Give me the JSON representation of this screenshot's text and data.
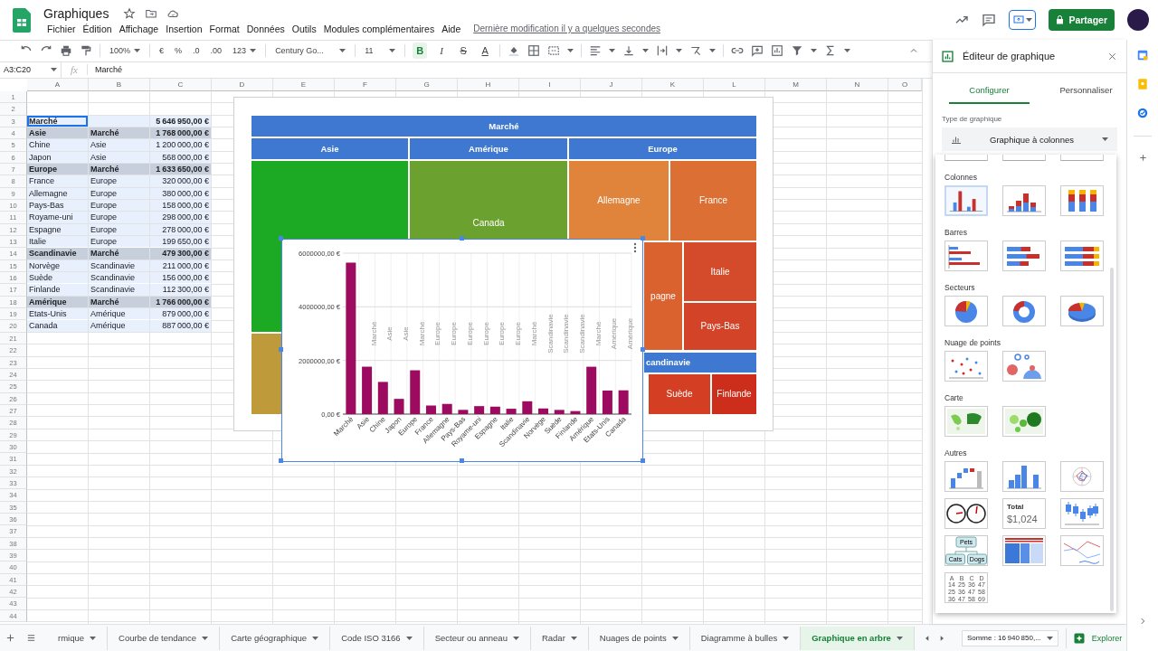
{
  "app": {
    "title": "Graphiques",
    "menus": [
      "Fichier",
      "Édition",
      "Affichage",
      "Insertion",
      "Format",
      "Données",
      "Outils",
      "Modules complémentaires",
      "Aide"
    ],
    "last_edit": "Dernière modification il y a quelques secondes",
    "share_button": "Partager"
  },
  "toolbar": {
    "zoom": "100%",
    "currency": "€",
    "percent": "%",
    "decrease_decimals": ".0",
    "increase_decimals": ".00",
    "number_format": "123",
    "font": "Century Go...",
    "font_size": "11",
    "styles": [
      {
        "label": "B",
        "on": true
      },
      {
        "label": "I",
        "on": false
      },
      {
        "label": "S",
        "on": false
      },
      {
        "label": "A",
        "on": false
      }
    ]
  },
  "formula_bar": {
    "range": "A3:C20",
    "fx_label": "fx",
    "formula": "Marché"
  },
  "sheet": {
    "columns": [
      "A",
      "B",
      "C",
      "D",
      "E",
      "F",
      "G",
      "H",
      "I",
      "J",
      "K",
      "L",
      "M",
      "N",
      "O"
    ],
    "rows": [
      {
        "number": "1",
        "selected": false
      },
      {
        "number": "2",
        "selected": false
      },
      {
        "number": "3",
        "selected": true,
        "active": true,
        "kind": "total",
        "cells": {
          "A": "Marché",
          "C": "5 646 950,00 €"
        }
      },
      {
        "number": "4",
        "selected": true,
        "active": false,
        "kind": "group",
        "cells": {
          "A": "Asie",
          "B": "Marché",
          "C": "1 768 000,00 €"
        }
      },
      {
        "number": "5",
        "selected": true,
        "active": false,
        "kind": "item",
        "cells": {
          "A": "Chine",
          "B": "Asie",
          "C": "1 200 000,00 €"
        }
      },
      {
        "number": "6",
        "selected": true,
        "active": false,
        "kind": "item",
        "cells": {
          "A": "Japon",
          "B": "Asie",
          "C": "568 000,00 €"
        }
      },
      {
        "number": "7",
        "selected": true,
        "active": false,
        "kind": "group",
        "cells": {
          "A": "Europe",
          "B": "Marché",
          "C": "1 633 650,00 €"
        }
      },
      {
        "number": "8",
        "selected": true,
        "active": false,
        "kind": "item",
        "cells": {
          "A": "France",
          "B": "Europe",
          "C": "320 000,00 €"
        }
      },
      {
        "number": "9",
        "selected": true,
        "active": false,
        "kind": "item",
        "cells": {
          "A": "Allemagne",
          "B": "Europe",
          "C": "380 000,00 €"
        }
      },
      {
        "number": "10",
        "selected": true,
        "active": false,
        "kind": "item",
        "cells": {
          "A": "Pays-Bas",
          "B": "Europe",
          "C": "158 000,00 €"
        }
      },
      {
        "number": "11",
        "selected": true,
        "active": false,
        "kind": "item",
        "cells": {
          "A": "Royame-uni",
          "B": "Europe",
          "C": "298 000,00 €"
        }
      },
      {
        "number": "12",
        "selected": true,
        "active": false,
        "kind": "item",
        "cells": {
          "A": "Espagne",
          "B": "Europe",
          "C": "278 000,00 €"
        }
      },
      {
        "number": "13",
        "selected": true,
        "active": false,
        "kind": "item",
        "cells": {
          "A": "Italie",
          "B": "Europe",
          "C": "199 650,00 €"
        }
      },
      {
        "number": "14",
        "selected": true,
        "active": false,
        "kind": "group",
        "cells": {
          "A": "Scandinavie",
          "B": "Marché",
          "C": "479 300,00 €"
        }
      },
      {
        "number": "15",
        "selected": true,
        "active": false,
        "kind": "item",
        "cells": {
          "A": "Norvège",
          "B": "Scandinavie",
          "C": "211 000,00 €"
        }
      },
      {
        "number": "16",
        "selected": true,
        "active": false,
        "kind": "item",
        "cells": {
          "A": "Suède",
          "B": "Scandinavie",
          "C": "156 000,00 €"
        }
      },
      {
        "number": "17",
        "selected": true,
        "active": false,
        "kind": "item",
        "cells": {
          "A": "Finlande",
          "B": "Scandinavie",
          "C": "112 300,00 €"
        }
      },
      {
        "number": "18",
        "selected": true,
        "active": false,
        "kind": "group",
        "cells": {
          "A": "Amérique",
          "B": "Marché",
          "C": "1 766 000,00 €"
        }
      },
      {
        "number": "19",
        "selected": true,
        "active": false,
        "kind": "item",
        "cells": {
          "A": "Etats-Unis",
          "B": "Amérique",
          "C": "879 000,00 €"
        }
      },
      {
        "number": "20",
        "selected": true,
        "active": false,
        "kind": "item",
        "cells": {
          "A": "Canada",
          "B": "Amérique",
          "C": "887 000,00 €"
        }
      },
      {
        "number": "21",
        "selected": false
      },
      {
        "number": "22",
        "selected": false
      },
      {
        "number": "23",
        "selected": false
      },
      {
        "number": "24",
        "selected": false
      },
      {
        "number": "25",
        "selected": false
      },
      {
        "number": "26",
        "selected": false
      },
      {
        "number": "27",
        "selected": false
      },
      {
        "number": "28",
        "selected": false
      },
      {
        "number": "29",
        "selected": false
      },
      {
        "number": "30",
        "selected": false
      },
      {
        "number": "31",
        "selected": false
      },
      {
        "number": "32",
        "selected": false
      },
      {
        "number": "33",
        "selected": false
      },
      {
        "number": "34",
        "selected": false
      },
      {
        "number": "35",
        "selected": false
      },
      {
        "number": "36",
        "selected": false
      },
      {
        "number": "37",
        "selected": false
      },
      {
        "number": "38",
        "selected": false
      },
      {
        "number": "39",
        "selected": false
      },
      {
        "number": "40",
        "selected": false
      },
      {
        "number": "41",
        "selected": false
      },
      {
        "number": "42",
        "selected": false
      },
      {
        "number": "43",
        "selected": false
      },
      {
        "number": "44",
        "selected": false
      }
    ]
  },
  "treemap": {
    "title": "Marché",
    "groups": [
      {
        "label": "Asie"
      },
      {
        "label": "Amérique"
      },
      {
        "label": "Europe"
      }
    ],
    "subheader": "candinavie",
    "cells": [
      {
        "color": "#1caa24"
      },
      {
        "color": "#bf9a3b"
      },
      {
        "color": "#6ba22f",
        "label": "Canada"
      },
      {
        "color": "#e0843b",
        "label": "Allemagne"
      },
      {
        "color": "#dc6f33",
        "label": "France"
      },
      {
        "color": "#d9622f",
        "label": "pagne"
      },
      {
        "color": "#d44b2b",
        "label": "Italie"
      },
      {
        "color": "#d24327",
        "label": "Pays-Bas"
      },
      {
        "color": "#d43f24",
        "label": "Suède"
      },
      {
        "color": "#cd2e1c",
        "label": "Finlande"
      }
    ]
  },
  "column_chart": {
    "chart_data": {
      "type": "bar",
      "orientation": "vertical",
      "grid": true,
      "categories": [
        "Marché",
        "Asie",
        "Chine",
        "Japon",
        "Europe",
        "France",
        "Allemagne",
        "Pays-Bas",
        "Royame-uni",
        "Espagne",
        "Italie",
        "Scandinavie",
        "Norvège",
        "Suède",
        "Finlande",
        "Amérique",
        "Etats-Unis",
        "Canada"
      ],
      "series": [
        {
          "color": "#9c0b5f",
          "values": [
            5646950,
            1768000,
            1200000,
            568000,
            1633650,
            320000,
            380000,
            158000,
            298000,
            278000,
            199650,
            479300,
            211000,
            156000,
            112300,
            1766000,
            879000,
            887000
          ]
        }
      ],
      "ylim": [
        0,
        6000000
      ],
      "yticks": [
        {
          "value": 0,
          "label": "0,00 €"
        },
        {
          "value": 2000000,
          "label": "2000000,00 €"
        },
        {
          "value": 4000000,
          "label": "4000000,00 €"
        },
        {
          "value": 6000000,
          "label": "6000000,00 €"
        }
      ],
      "annotations": [
        null,
        "Marché",
        "Asie",
        "Asie",
        "Marché",
        "Europe",
        "Europe",
        "Europe",
        "Europe",
        "Europe",
        "Europe",
        "Marché",
        "Scandinavie",
        "Scandinavie",
        "Scandinavie",
        "Marché",
        "Amérique",
        "Amérique"
      ]
    }
  },
  "chart_editor": {
    "title": "Éditeur de graphique",
    "tabs": [
      {
        "label": "Configurer",
        "selected": true
      },
      {
        "label": "Personnaliser",
        "selected": false
      }
    ],
    "type_label": "Type de graphique",
    "type_value": "Graphique à colonnes",
    "sections": [
      {
        "options": [
          {
            "kind": "clipped",
            "selected": false
          },
          {
            "kind": "clipped",
            "selected": false
          },
          {
            "kind": "clipped",
            "selected": false
          }
        ]
      },
      {
        "title": "Colonnes",
        "options": [
          {
            "kind": "column",
            "selected": true
          },
          {
            "kind": "stacked-column",
            "selected": false
          },
          {
            "kind": "full-stacked-column",
            "selected": false
          }
        ]
      },
      {
        "title": "Barres",
        "options": [
          {
            "kind": "bar",
            "selected": false
          },
          {
            "kind": "stacked-bar",
            "selected": false
          },
          {
            "kind": "full-stacked-bar",
            "selected": false
          }
        ]
      },
      {
        "title": "Secteurs",
        "options": [
          {
            "kind": "pie",
            "selected": false
          },
          {
            "kind": "donut",
            "selected": false
          },
          {
            "kind": "pie-3d",
            "selected": false
          }
        ]
      },
      {
        "title": "Nuage de points",
        "options": [
          {
            "kind": "scatter",
            "selected": false
          },
          {
            "kind": "bubble",
            "selected": false
          }
        ]
      },
      {
        "title": "Carte",
        "options": [
          {
            "kind": "geo",
            "selected": false
          },
          {
            "kind": "geo-markers",
            "selected": false
          }
        ]
      },
      {
        "title": "Autres",
        "options": [
          {
            "kind": "waterfall",
            "selected": false
          },
          {
            "kind": "histogram",
            "selected": false
          },
          {
            "kind": "radar",
            "selected": false
          },
          {
            "kind": "gauge",
            "selected": false
          },
          {
            "kind": "scorecard",
            "selected": false,
            "texts": [
              "Total",
              "$1,024"
            ]
          },
          {
            "kind": "candlestick",
            "selected": false
          },
          {
            "kind": "org",
            "selected": false,
            "texts": [
              "Pets",
              "Cats",
              "Dogs"
            ]
          },
          {
            "kind": "treemap",
            "selected": false
          },
          {
            "kind": "timeline",
            "selected": false
          },
          {
            "kind": "table",
            "selected": false,
            "texts": [
              "A",
              "B",
              "C",
              "D",
              "14",
              "25",
              "36",
              "47",
              "25",
              "36",
              "47",
              "58",
              "36",
              "47",
              "58",
              "69"
            ]
          }
        ]
      }
    ]
  },
  "sheet_tabs": [
    {
      "label": "rmique",
      "selected": false
    },
    {
      "label": "Courbe de tendance",
      "selected": false
    },
    {
      "label": "Carte géographique",
      "selected": false
    },
    {
      "label": "Code ISO 3166",
      "selected": false
    },
    {
      "label": "Secteur ou anneau",
      "selected": false
    },
    {
      "label": "Radar",
      "selected": false
    },
    {
      "label": "Nuages de points",
      "selected": false
    },
    {
      "label": "Diagramme à bulles",
      "selected": false
    },
    {
      "label": "Graphique en arbre",
      "selected": true
    }
  ],
  "status": {
    "sum": "Somme : 16 940 850,...",
    "explore": "Explorer"
  }
}
